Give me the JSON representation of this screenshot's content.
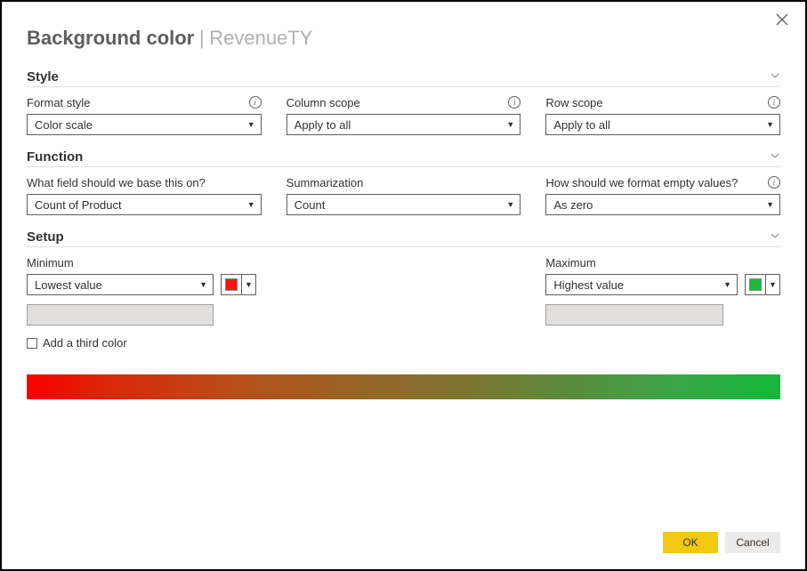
{
  "header": {
    "title": "Background color",
    "context": "RevenueTY"
  },
  "sections": {
    "style": {
      "title": "Style",
      "formatStyle": {
        "label": "Format style",
        "value": "Color scale"
      },
      "columnScope": {
        "label": "Column scope",
        "value": "Apply to all"
      },
      "rowScope": {
        "label": "Row scope",
        "value": "Apply to all"
      }
    },
    "function": {
      "title": "Function",
      "baseField": {
        "label": "What field should we base this on?",
        "value": "Count of Product"
      },
      "summarization": {
        "label": "Summarization",
        "value": "Count"
      },
      "emptyValues": {
        "label": "How should we format empty values?",
        "value": "As zero"
      }
    },
    "setup": {
      "title": "Setup",
      "minimum": {
        "label": "Minimum",
        "value": "Lowest value",
        "color": "#fa1414"
      },
      "maximum": {
        "label": "Maximum",
        "value": "Highest value",
        "color": "#1ab83d"
      },
      "thirdColor": {
        "label": "Add a third color"
      }
    }
  },
  "footer": {
    "ok": "OK",
    "cancel": "Cancel"
  },
  "colors": {
    "gradientStart": "#fa0000",
    "gradientEnd": "#12b837",
    "accent": "#f2c811"
  }
}
